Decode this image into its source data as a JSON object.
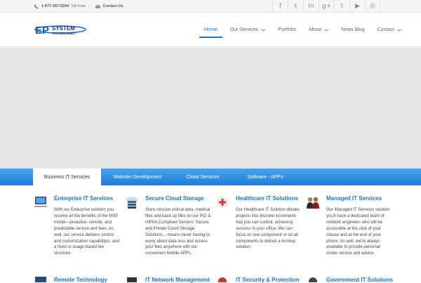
{
  "topbar": {
    "phone": "1-877-457-5244",
    "phone_suffix": "Toll Free",
    "separator": "/",
    "contact_label": "Contact Us",
    "social_icons": [
      "facebook-icon",
      "twitter-icon",
      "linkedin-icon",
      "google-plus-icon",
      "tumblr-icon",
      "youtube-icon",
      "rss-icon"
    ],
    "social_glyphs": [
      "f",
      "t",
      "in",
      "g+",
      "t",
      "▶",
      "◎"
    ]
  },
  "logo": {
    "letters": "EP",
    "word1": "SYSTEM",
    "word2": "TECHNOLOGIES"
  },
  "nav": {
    "items": [
      {
        "label": "Home",
        "active": true
      },
      {
        "label": "Our Services",
        "dropdown": true
      },
      {
        "label": "Portfolio"
      },
      {
        "label": "About",
        "dropdown": true
      },
      {
        "label": "News Blog"
      },
      {
        "label": "Contact",
        "dropdown": true
      }
    ]
  },
  "tabs": [
    "Business IT Services",
    "Website Development",
    "Cloud Services",
    "Software - APPs"
  ],
  "services": [
    {
      "title": "Enterprise IT Services",
      "text": "With our Enterprise solution you receive all the benefits of the MSP model—proactive, remote, and predictable service and fees. As well, our service delivers control and customization capabilities, and a fixed or usage-based fee structure."
    },
    {
      "title": "Secure Cloud Storage",
      "text": "Store mission critical data, medical files and back up files on our PCI & HIPAA Compliant Servers! Secure and Private Cloud Storage Solutions... means never having to worry about data loss and access your files anywhere with our convenient Mobile APPs."
    },
    {
      "title": "Healthcare IT Solutions",
      "text": "Our Healthcare IT Solution divides projects into discrete increments that you can control, achieving success in your office. We can focus on one component or on all components to deliver a turnkey solution."
    },
    {
      "title": "Managed IT Services",
      "text": "Our Managed IT Services solution you'll have a dedicated team of network engineers who will be accessible at the click of your mouse and at the end of your phone. As well, we're always available to provide personal onsite service and advice."
    }
  ],
  "services_row2": [
    "Remote Technology",
    "IT Network Management",
    "IT Security & Protection",
    "Government IT Solutions"
  ],
  "colors": {
    "accent": "#1a73c9",
    "tabbar": "#2a8ae0",
    "hero": "#e6e6e6"
  }
}
